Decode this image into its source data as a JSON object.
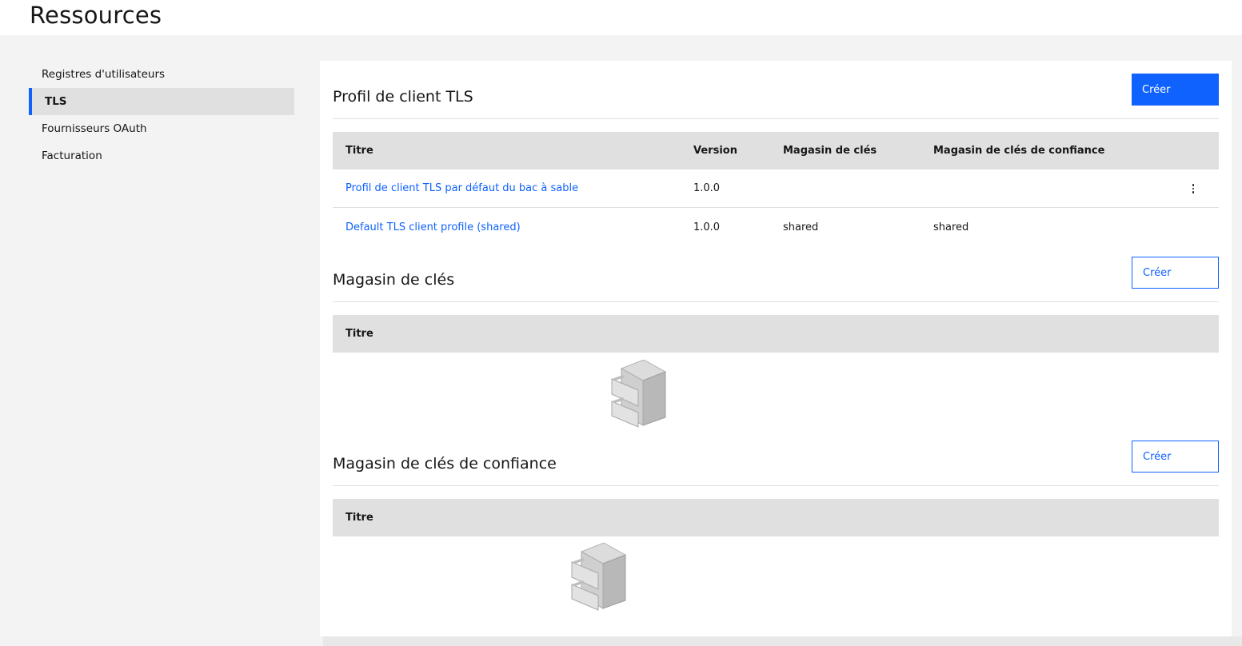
{
  "page": {
    "title": "Ressources"
  },
  "sidebar": {
    "items": [
      {
        "label": "Registres d'utilisateurs",
        "active": false
      },
      {
        "label": "TLS",
        "active": true
      },
      {
        "label": "Fournisseurs OAuth",
        "active": false
      },
      {
        "label": "Facturation",
        "active": false
      }
    ]
  },
  "sections": {
    "tls_client_profiles": {
      "title": "Profil de client TLS",
      "create_label": "Créer",
      "columns": [
        "Titre",
        "Version",
        "Magasin de clés",
        "Magasin de clés de confiance"
      ],
      "rows": [
        {
          "title": "Profil de client TLS par défaut du bac à sable",
          "version": "1.0.0",
          "keystore": "",
          "truststore": "",
          "overflow_icon": "overflow-menu-vertical-icon"
        },
        {
          "title": "Default TLS client profile (shared)",
          "version": "1.0.0",
          "keystore": "shared",
          "truststore": "shared"
        }
      ]
    },
    "keystores": {
      "title": "Magasin de clés",
      "create_label": "Créer",
      "columns": [
        "Titre"
      ],
      "empty_icon": "filing-cabinet-icon"
    },
    "truststores": {
      "title": "Magasin de clés de confiance",
      "create_label": "Créer",
      "columns": [
        "Titre"
      ],
      "empty_icon": "filing-cabinet-icon"
    }
  },
  "colors": {
    "accent": "#0f62fe",
    "background": "#f3f3f3",
    "header_row": "#e0e0e0"
  }
}
